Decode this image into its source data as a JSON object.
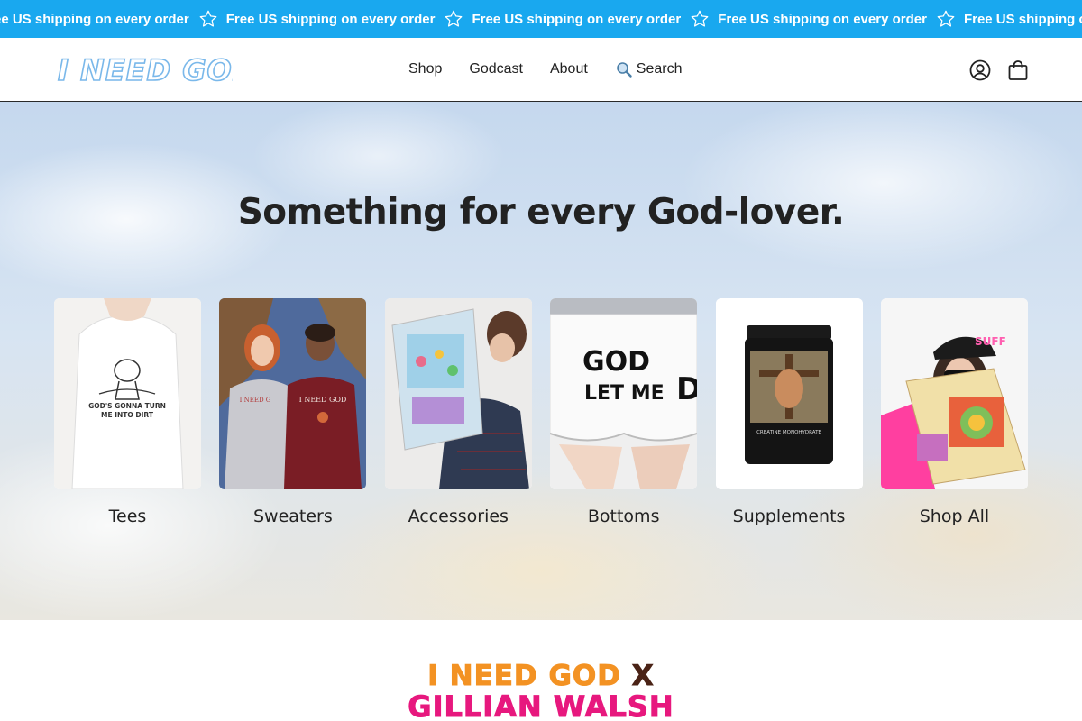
{
  "announcement": {
    "text": "Free US shipping on every order",
    "color": "#19a8ef"
  },
  "header": {
    "logo_text": "I NEED GOD",
    "nav": [
      {
        "label": "Shop"
      },
      {
        "label": "Godcast"
      },
      {
        "label": "About"
      }
    ],
    "search_label": "Search",
    "icons": [
      "account-icon",
      "cart-icon"
    ]
  },
  "hero": {
    "title": "Something for every God-lover.",
    "categories": [
      {
        "label": "Tees",
        "image": "tee-image"
      },
      {
        "label": "Sweaters",
        "image": "sweaters-image"
      },
      {
        "label": "Accessories",
        "image": "accessories-image"
      },
      {
        "label": "Bottoms",
        "image": "bottoms-image"
      },
      {
        "label": "Supplements",
        "image": "supplements-image"
      },
      {
        "label": "Shop All",
        "image": "shop-all-image"
      }
    ]
  },
  "collab": {
    "brand": "I NEED GOD",
    "x": "X",
    "partner": "GILLIAN WALSH",
    "brand_color": "#f39223",
    "partner_color": "#e7187e"
  }
}
